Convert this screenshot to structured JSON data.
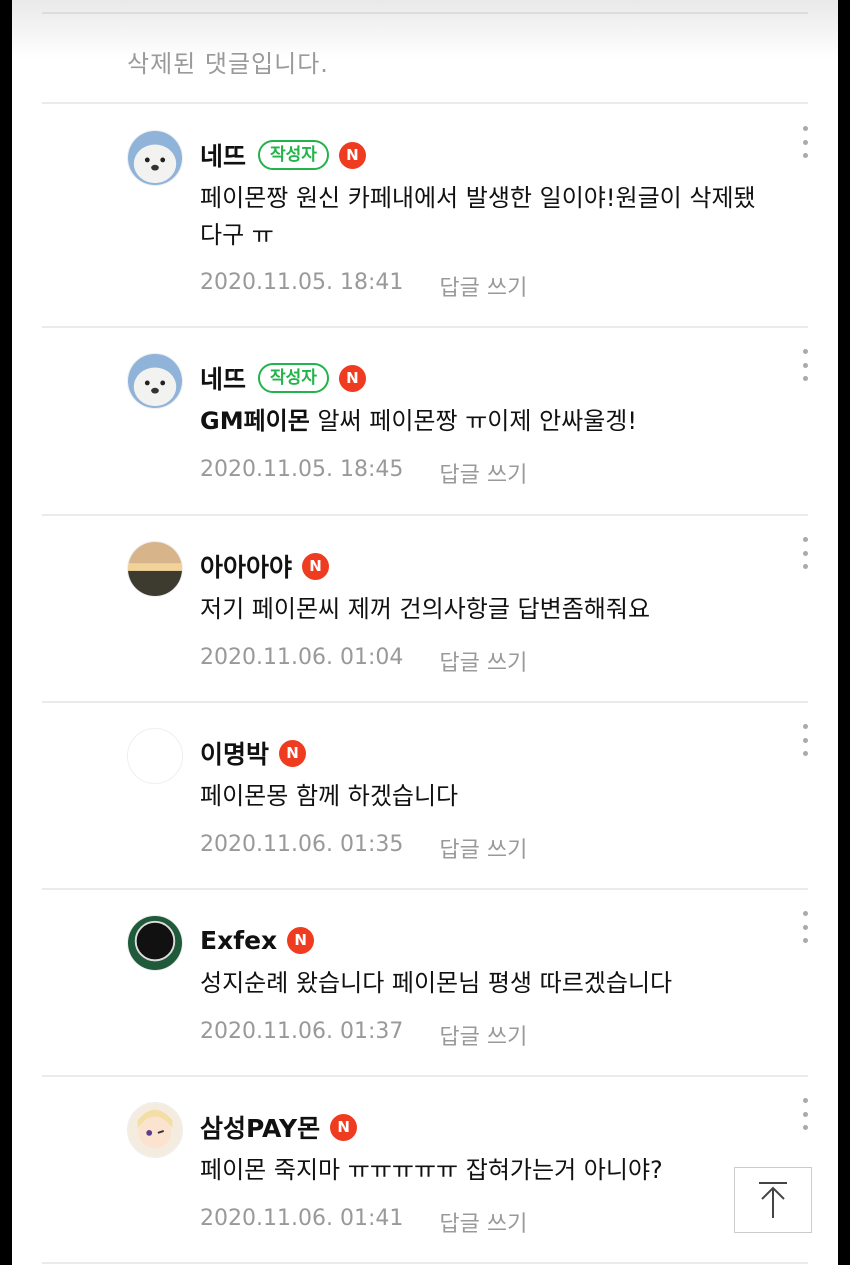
{
  "deleted_notice": "삭제된 댓글입니다.",
  "labels": {
    "writer_badge": "작성자",
    "n_badge": "N",
    "reply": "답글 쓰기"
  },
  "comments": [
    {
      "nickname": "네뜨",
      "is_writer": true,
      "text": "페이몬짱 원신 카페내에서 발생한 일이야!원글이 삭제됐다구 ㅠ",
      "date": "2020.11.05. 18:41",
      "avatar_icon": "seal-avatar-icon"
    },
    {
      "nickname": "네뜨",
      "is_writer": true,
      "mention": "GM페이몬",
      "text": " 알써 페이몬짱 ㅠ이제 안싸울겡!",
      "date": "2020.11.05. 18:45",
      "avatar_icon": "seal-avatar-icon"
    },
    {
      "nickname": "아아아야",
      "is_writer": false,
      "text": "저기 페이몬씨 제꺼 건의사항글 답변좀해줘요",
      "date": "2020.11.06. 01:04",
      "avatar_icon": "sunset-avatar-icon"
    },
    {
      "nickname": "이명박",
      "is_writer": false,
      "text": "페이몬몽 함께 하겠습니다",
      "date": "2020.11.06. 01:35",
      "avatar_icon": "empty-avatar-icon"
    },
    {
      "nickname": "Exfex",
      "is_writer": false,
      "text": "성지순례 왔습니다 페이몬님 평생 따르겠습니다",
      "date": "2020.11.06. 01:37",
      "avatar_icon": "dark-circle-avatar-icon"
    },
    {
      "nickname": "삼성PAY몬",
      "is_writer": false,
      "text": "페이몬 죽지마 ㅠㅠㅠㅠㅠ 잡혀가는거 아니야?",
      "date": "2020.11.06. 01:41",
      "avatar_icon": "character-avatar-icon"
    }
  ],
  "colors": {
    "writer_badge": "#22b34a",
    "n_badge": "#ef3b1f",
    "meta_text": "#999999"
  }
}
